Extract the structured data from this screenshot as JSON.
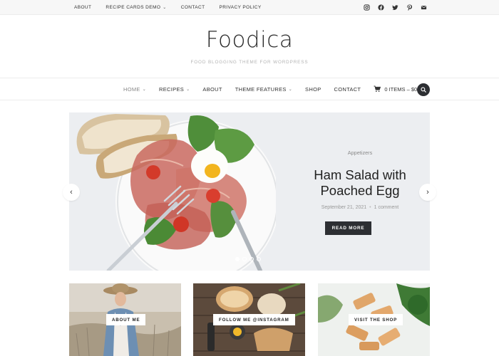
{
  "topbar": {
    "links": [
      {
        "label": "ABOUT"
      },
      {
        "label": "RECIPE CARDS DEMO",
        "has_dropdown": true
      },
      {
        "label": "CONTACT"
      },
      {
        "label": "PRIVACY POLICY"
      }
    ],
    "social_icons": [
      "instagram-icon",
      "facebook-icon",
      "twitter-icon",
      "pinterest-icon",
      "email-icon"
    ]
  },
  "site": {
    "title": "Foodica",
    "tagline": "FOOD BLOGGING THEME FOR WORDPRESS"
  },
  "mainnav": {
    "items": [
      {
        "label": "HOME",
        "active": true,
        "has_dropdown": true
      },
      {
        "label": "RECIPES",
        "has_dropdown": true
      },
      {
        "label": "ABOUT"
      },
      {
        "label": "THEME FEATURES",
        "has_dropdown": true
      },
      {
        "label": "SHOP"
      },
      {
        "label": "CONTACT"
      }
    ],
    "cart_label": "0 ITEMS – $0.00",
    "search_icon": "search-icon"
  },
  "slider": {
    "category": "Appetizers",
    "title_line1": "Ham Salad with",
    "title_line2": "Poached Egg",
    "date": "September 21, 2021",
    "comments": "1 comment",
    "read_more": "READ MORE",
    "slide_count": 4,
    "active_slide": 1
  },
  "cards": [
    {
      "label": "ABOUT ME"
    },
    {
      "label": "FOLLOW ME @INSTAGRAM"
    },
    {
      "label": "VISIT THE SHOP"
    }
  ],
  "colors": {
    "dark_button": "#2d2f33",
    "slider_bg": "#eceef1",
    "topbar_bg": "#f7f7f7"
  }
}
